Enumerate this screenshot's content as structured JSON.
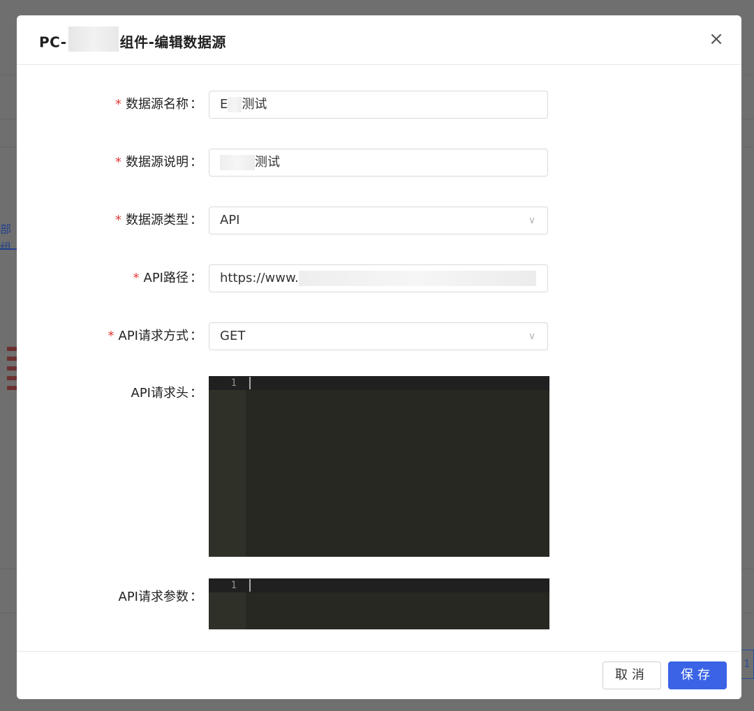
{
  "modal": {
    "title_prefix": "PC-",
    "title_suffix": "组件-编辑数据源",
    "close_icon": "×"
  },
  "form": {
    "name": {
      "label": "数据源名称",
      "required_mark": "*",
      "value_prefix": "E",
      "value_suffix": "测试"
    },
    "description": {
      "label": "数据源说明",
      "required_mark": "*",
      "value_suffix": "测试"
    },
    "type": {
      "label": "数据源类型",
      "required_mark": "*",
      "value": "API"
    },
    "api_path": {
      "label": "API路径",
      "required_mark": "*",
      "value_prefix": "https://www."
    },
    "api_method": {
      "label": "API请求方式",
      "required_mark": "*",
      "value": "GET"
    },
    "api_headers": {
      "label": "API请求头",
      "line_number": "1"
    },
    "api_params": {
      "label": "API请求参数",
      "line_number": "1"
    },
    "colon": "："
  },
  "footer": {
    "cancel_label": "取消",
    "save_label": "保存"
  },
  "background": {
    "tab_fragment": "部组",
    "page_number": "1"
  },
  "colors": {
    "primary": "#3a63e6",
    "required": "#e53935",
    "editor_bg": "#272822"
  }
}
